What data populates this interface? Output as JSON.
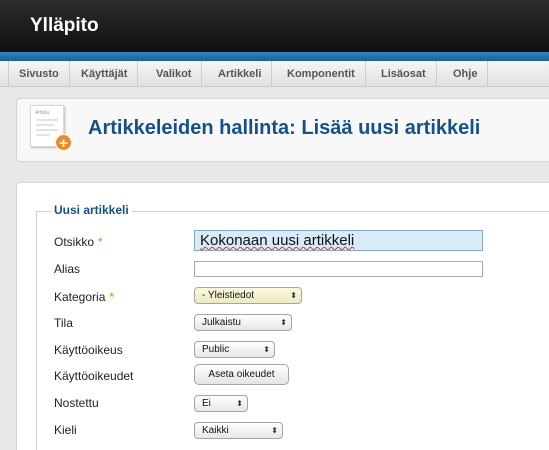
{
  "app": {
    "title": "Ylläpito"
  },
  "menu": [
    {
      "label": "Sivusto"
    },
    {
      "label": "Käyttäjät"
    },
    {
      "label": "Valikot"
    },
    {
      "label": "Artikkeli"
    },
    {
      "label": "Komponentit"
    },
    {
      "label": "Lisäosat"
    },
    {
      "label": "Ohje"
    }
  ],
  "header": {
    "icon": "article-add-icon",
    "icon_text": "Artikla",
    "title": "Artikkeleiden hallinta: Lisää uusi artikkeli"
  },
  "form": {
    "legend": "Uusi artikkeli",
    "required_marker": "*",
    "fields": {
      "title": {
        "label": "Otsikko",
        "value": "Kokonaan uusi artikkeli"
      },
      "alias": {
        "label": "Alias",
        "value": ""
      },
      "category": {
        "label": "Kategoria",
        "value": "- Yleistiedot"
      },
      "status": {
        "label": "Tila",
        "value": "Julkaistu"
      },
      "access": {
        "label": "Käyttöoikeus",
        "value": "Public"
      },
      "permissions": {
        "label": "Käyttöoikeudet",
        "button": "Aseta oikeudet"
      },
      "featured": {
        "label": "Nostettu",
        "value": "Ei"
      },
      "language": {
        "label": "Kieli",
        "value": "Kaikki"
      }
    }
  },
  "colors": {
    "brand_blue": "#14518c",
    "accent_orange": "#f08a1c",
    "required": "#e07b00"
  }
}
